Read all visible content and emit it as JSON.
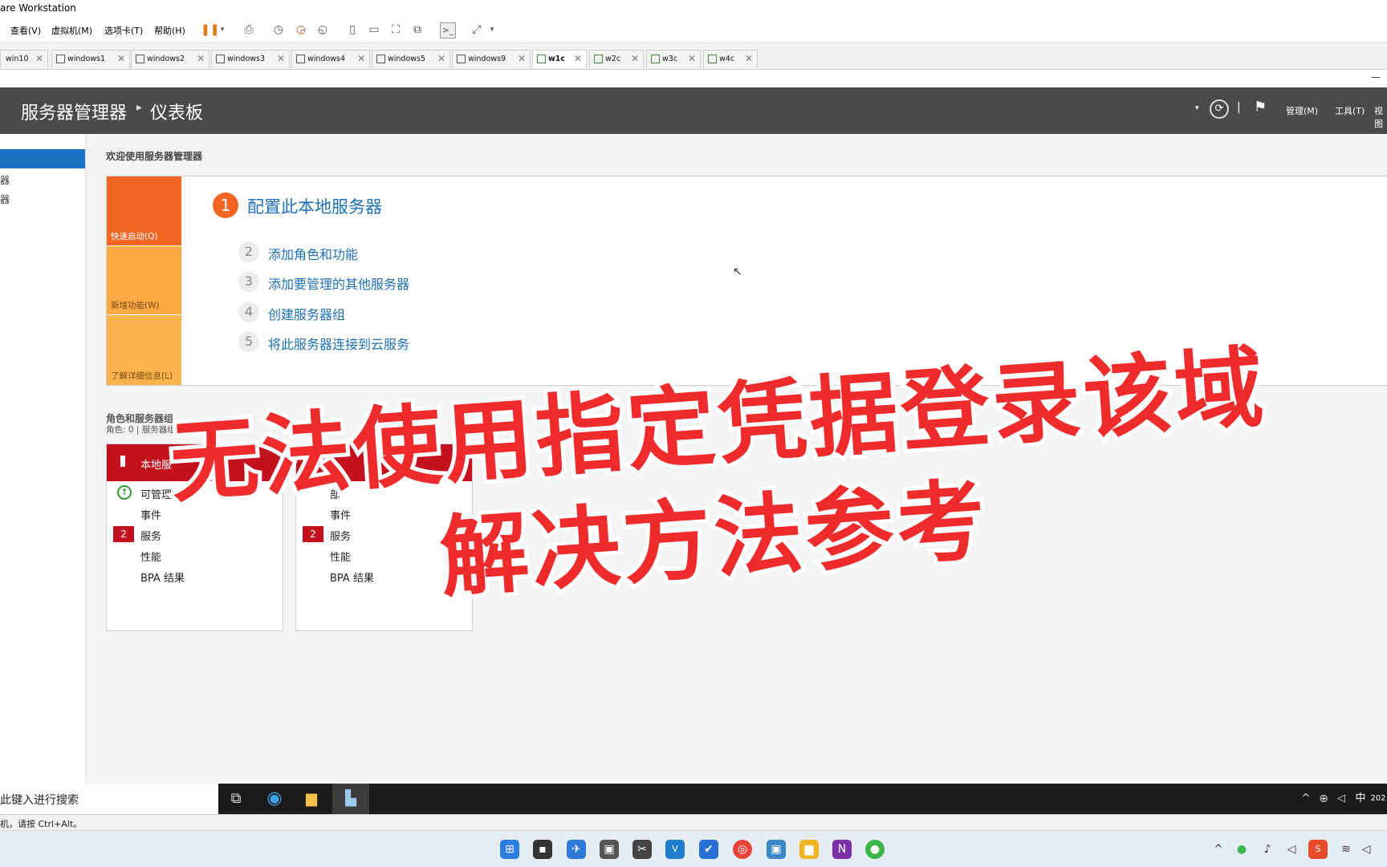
{
  "window": {
    "title": "are Workstation"
  },
  "menu": [
    "查看(V)",
    "虚拟机(M)",
    "选项卡(T)",
    "帮助(H)"
  ],
  "tabs": [
    {
      "label": "win10"
    },
    {
      "label": "windows1"
    },
    {
      "label": "windows2"
    },
    {
      "label": "windows3"
    },
    {
      "label": "windows4"
    },
    {
      "label": "windows5"
    },
    {
      "label": "windows9"
    },
    {
      "label": "w1c"
    },
    {
      "label": "w2c"
    },
    {
      "label": "w3c"
    },
    {
      "label": "w4c"
    }
  ],
  "server_manager": {
    "title": "服务器管理器",
    "separator": "▸",
    "page": "仪表板",
    "header_menu": {
      "manage": "管理(M)",
      "tools": "工具(T)",
      "view": "视图"
    }
  },
  "sidebar": {
    "items": [
      "器",
      "器"
    ]
  },
  "welcome": {
    "title": "欢迎使用服务器管理器",
    "blocks": [
      "快速启动(Q)",
      "新增功能(W)",
      "了解详细信息(L)"
    ],
    "steps": [
      {
        "num": "1",
        "label": "配置此本地服务器"
      },
      {
        "num": "2",
        "label": "添加角色和功能"
      },
      {
        "num": "3",
        "label": "添加要管理的其他服务器"
      },
      {
        "num": "4",
        "label": "创建服务器组"
      },
      {
        "num": "5",
        "label": "将此服务器连接到云服务"
      }
    ]
  },
  "roles": {
    "title": "角色和服务器组",
    "subtitle": "角色: 0 | 服务器组",
    "cards": [
      {
        "header": "本地服",
        "rows": {
          "manage": "可管理",
          "events": "事件",
          "services": "服务",
          "perf": "性能",
          "bpa": "BPA 结果"
        },
        "services_badge": "2"
      },
      {
        "header": "",
        "rows": {
          "manage": "部",
          "events": "事件",
          "services": "服务",
          "perf": "性能",
          "bpa": "BPA 结果"
        },
        "services_badge": "2"
      }
    ]
  },
  "guest_taskbar": {
    "search_text": "此键入进行搜索"
  },
  "vm_status": {
    "text": "机，请按 Ctrl+Alt。"
  },
  "overlay": {
    "line1": "无法使用指定凭据登录该域",
    "line2": "解决方法参考"
  },
  "tray": {
    "ime": "中",
    "year": "202"
  },
  "colors": {
    "accent_orange": "#f26522",
    "accent_red": "#c4111e",
    "link_blue": "#1e6fb5",
    "overlay_red": "#ef2b2b"
  }
}
